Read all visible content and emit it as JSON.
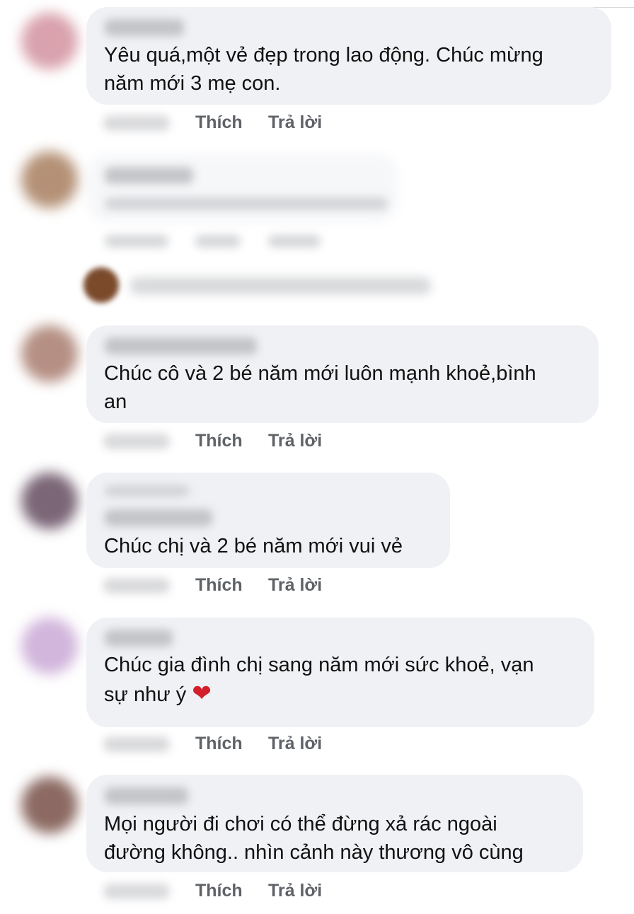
{
  "comments": [
    {
      "text": "Yêu quá,một vẻ đẹp trong lao động. Chúc mừng\nnăm mới 3 mẹ con.",
      "like_label": "Thích",
      "reply_label": "Trả lời",
      "avatar_color": "#d9a2ad"
    },
    {
      "avatar_color": "#b49176"
    },
    {
      "text": "Chúc cô và 2 bé năm mới luôn mạnh khoẻ,bình\nan",
      "like_label": "Thích",
      "reply_label": "Trả lời",
      "avatar_color": "#b58f83"
    },
    {
      "text": "Chúc chị và 2 bé năm mới vui vẻ",
      "like_label": "Thích",
      "reply_label": "Trả lời",
      "avatar_color": "#7a6677"
    },
    {
      "text": "Chúc gia đình chị sang năm mới sức khoẻ, vạn\nsự như ý ",
      "emoji": "❤",
      "like_label": "Thích",
      "reply_label": "Trả lời",
      "avatar_color": "#d2b6dc"
    },
    {
      "text": "Mọi người đi chơi có thể đừng xả rác ngoài\nđường không.. nhìn cảnh này thương vô cùng",
      "like_label": "Thích",
      "reply_label": "Trả lời",
      "avatar_color": "#8c6a63"
    }
  ],
  "colors": {
    "bubble": "#eff1f4",
    "action_text": "#5f6368",
    "heart": "#d21f2b"
  },
  "icons": {
    "heart": "heart-emoji"
  }
}
